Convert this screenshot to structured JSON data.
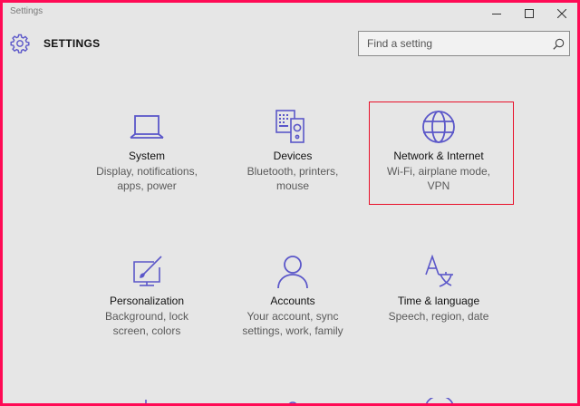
{
  "window": {
    "title": "Settings"
  },
  "header": {
    "heading": "SETTINGS",
    "search_placeholder": "Find a setting"
  },
  "tiles": [
    {
      "icon": "laptop-icon",
      "label": "System",
      "desc": [
        "Display, notifications,",
        "apps, power"
      ]
    },
    {
      "icon": "devices-icon",
      "label": "Devices",
      "desc": [
        "Bluetooth, printers,",
        "mouse"
      ]
    },
    {
      "icon": "globe-icon",
      "label": "Network & Internet",
      "desc": [
        "Wi-Fi, airplane mode,",
        "VPN"
      ],
      "selected": true
    },
    {
      "icon": "personalization-icon",
      "label": "Personalization",
      "desc": [
        "Background, lock",
        "screen, colors"
      ]
    },
    {
      "icon": "person-icon",
      "label": "Accounts",
      "desc": [
        "Your account, sync",
        "settings, work, family"
      ]
    },
    {
      "icon": "time-language-icon",
      "label": "Time & language",
      "desc": [
        "Speech, region, date"
      ]
    }
  ],
  "colors": {
    "accent": "#5b57c9",
    "background": "#e6e6e6",
    "frame_border": "#ff0a55",
    "selection_border": "#e8102a"
  }
}
